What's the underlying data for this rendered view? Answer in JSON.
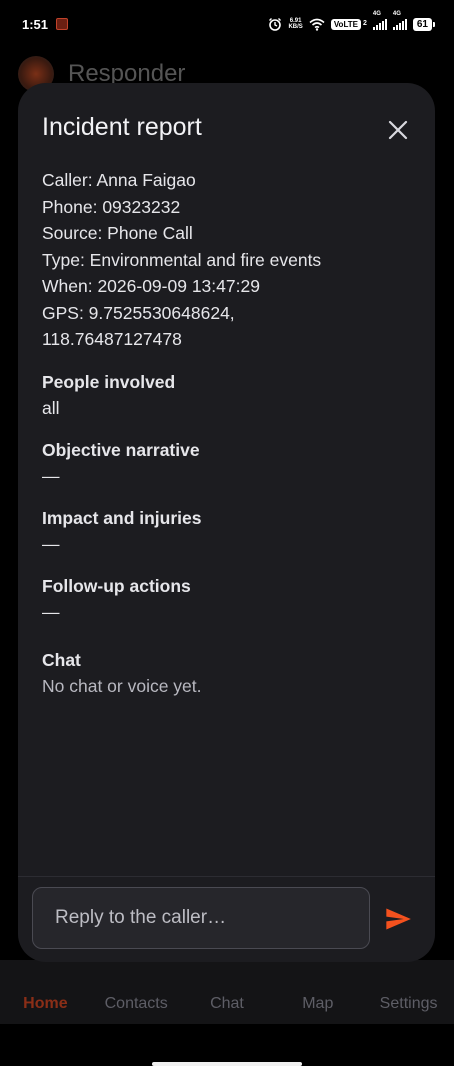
{
  "status_bar": {
    "time": "1:51",
    "net_speed_top": "6.91",
    "net_speed_unit": "KB/S",
    "volte": "VoLTE",
    "sim2": "2",
    "signal1_label": "4G",
    "signal2_label": "4G",
    "battery": "61"
  },
  "background_app": {
    "title": "Responder",
    "nav": [
      {
        "label": "Home",
        "active": true
      },
      {
        "label": "Contacts"
      },
      {
        "label": "Chat"
      },
      {
        "label": "Map"
      },
      {
        "label": "Settings"
      }
    ]
  },
  "sheet": {
    "title": "Incident report",
    "details": {
      "caller": "Caller: Anna Faigao",
      "phone": "Phone: 09323232",
      "source": "Source: Phone Call",
      "type": "Type: Environmental and fire events",
      "when": "When: 2026-09-09 13:47:29",
      "gps_line1": "GPS: 9.7525530648624,",
      "gps_line2": "118.76487127478"
    },
    "sections": [
      {
        "label": "People involved",
        "value": "all"
      },
      {
        "label": "Objective narrative",
        "value": "—"
      },
      {
        "label": "Impact and injuries",
        "value": "—"
      },
      {
        "label": "Follow-up actions",
        "value": "—"
      }
    ],
    "chat": {
      "label": "Chat",
      "empty_text": "No chat or voice yet."
    },
    "reply": {
      "placeholder": "Reply to the caller…",
      "value": ""
    }
  },
  "colors": {
    "accent": "#f4511e",
    "sheet_bg": "#1c1c20",
    "nav_active": "#8a2e17"
  }
}
